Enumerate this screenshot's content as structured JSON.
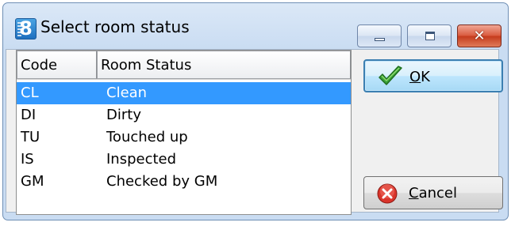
{
  "window": {
    "title": "Select room status",
    "app_icon": "8",
    "controls": [
      "minimize-icon",
      "maximize-icon",
      "close-icon"
    ]
  },
  "list": {
    "columns": [
      "Code",
      "Room Status"
    ],
    "rows": [
      {
        "code": "CL",
        "status": "Clean",
        "selected": true
      },
      {
        "code": "DI",
        "status": "Dirty",
        "selected": false
      },
      {
        "code": "TU",
        "status": "Touched up",
        "selected": false
      },
      {
        "code": "IS",
        "status": "Inspected",
        "selected": false
      },
      {
        "code": "GM",
        "status": "Checked by GM",
        "selected": false
      }
    ]
  },
  "buttons": {
    "ok": {
      "label_first": "O",
      "label_rest": "K",
      "icon": "checkmark-icon"
    },
    "cancel": {
      "label_first": "C",
      "label_rest": "ancel",
      "icon": "cancel-icon"
    }
  },
  "colors": {
    "selection": "#3399ff",
    "close_button": "#c43a1c",
    "ok_check": "#3aa33a"
  }
}
